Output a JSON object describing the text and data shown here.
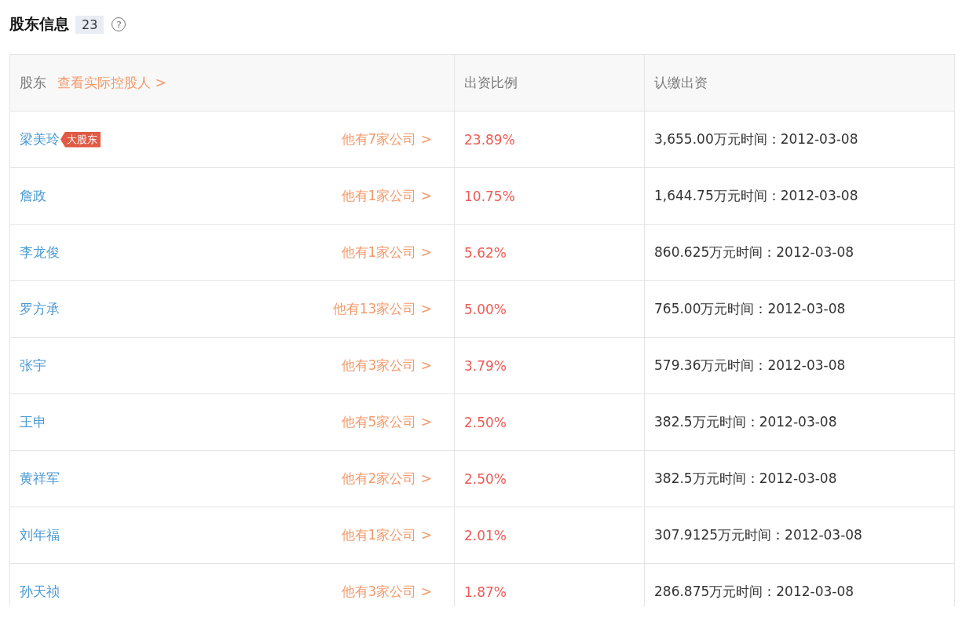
{
  "section": {
    "title": "股东信息",
    "count": "23",
    "help_icon": "?"
  },
  "table": {
    "columns": [
      {
        "label": "股东",
        "link": "查看实际控股人 >"
      },
      {
        "label": "出资比例"
      },
      {
        "label": "认缴出资"
      }
    ],
    "rows": [
      {
        "name": "梁美玲",
        "badge": "大股东",
        "companies": "他有7家公司 >",
        "ratio": "23.89%",
        "capital": "3,655.00万元时间：2012-03-08"
      },
      {
        "name": "詹政",
        "companies": "他有1家公司 >",
        "ratio": "10.75%",
        "capital": "1,644.75万元时间：2012-03-08"
      },
      {
        "name": "李龙俊",
        "companies": "他有1家公司 >",
        "ratio": "5.62%",
        "capital": "860.625万元时间：2012-03-08"
      },
      {
        "name": "罗方承",
        "companies": "他有13家公司 >",
        "ratio": "5.00%",
        "capital": "765.00万元时间：2012-03-08"
      },
      {
        "name": "张宇",
        "companies": "他有3家公司 >",
        "ratio": "3.79%",
        "capital": "579.36万元时间：2012-03-08"
      },
      {
        "name": "王申",
        "companies": "他有5家公司 >",
        "ratio": "2.50%",
        "capital": "382.5万元时间：2012-03-08"
      },
      {
        "name": "黄祥军",
        "companies": "他有2家公司 >",
        "ratio": "2.50%",
        "capital": "382.5万元时间：2012-03-08"
      },
      {
        "name": "刘年福",
        "companies": "他有1家公司 >",
        "ratio": "2.01%",
        "capital": "307.9125万元时间：2012-03-08"
      },
      {
        "name": "孙天祯",
        "companies": "他有3家公司 >",
        "ratio": "1.87%",
        "capital": "286.875万元时间：2012-03-08"
      }
    ]
  }
}
